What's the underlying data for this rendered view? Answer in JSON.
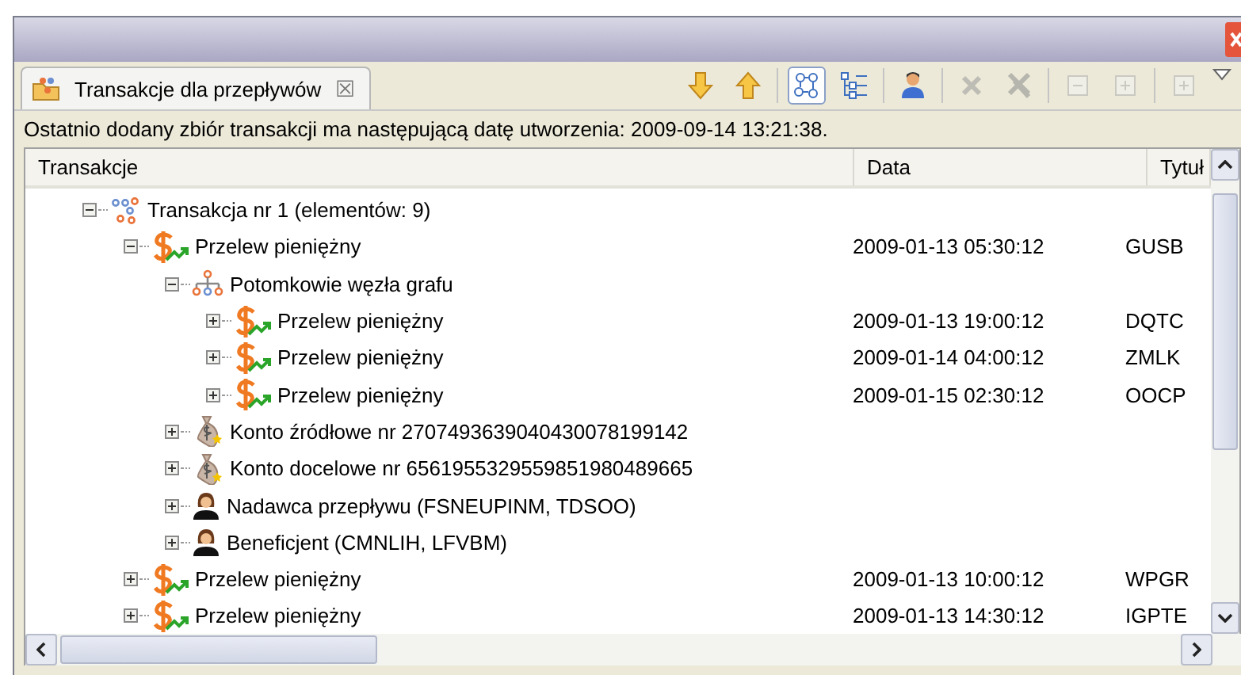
{
  "tab": {
    "label": "Transakcje dla przepływów",
    "close": "☒"
  },
  "toolbar": [
    {
      "kind": "down",
      "selected": false,
      "disabled": false
    },
    {
      "kind": "up",
      "selected": false,
      "disabled": false
    },
    {
      "kind": "graph",
      "selected": true,
      "disabled": false
    },
    {
      "kind": "tree",
      "selected": false,
      "disabled": false
    },
    {
      "kind": "person",
      "selected": false,
      "disabled": false
    },
    {
      "kind": "delete",
      "selected": false,
      "disabled": true
    },
    {
      "kind": "delete-all",
      "selected": false,
      "disabled": true
    },
    {
      "kind": "collapse",
      "selected": false,
      "disabled": true
    },
    {
      "kind": "expand",
      "selected": false,
      "disabled": true
    },
    {
      "kind": "expand",
      "selected": false,
      "disabled": true
    }
  ],
  "info": "Ostatnio dodany zbiór transakcji ma następującą datę utworzenia: 2009-09-14 13:21:38.",
  "table": {
    "columns": [
      "Transakcje",
      "Data",
      "Tytuł"
    ],
    "rows": [
      {
        "kind": "transaction",
        "label": "Transakcja nr 1 (elementów: 9)",
        "expanded": true,
        "children": [
          {
            "kind": "transfer",
            "label": "Przelew pieniężny",
            "date": "2009-01-13 05:30:12",
            "title": "GUSB",
            "expanded": true,
            "children": [
              {
                "kind": "graph",
                "label": "Potomkowie węzła grafu",
                "expanded": true,
                "children": [
                  {
                    "kind": "transfer",
                    "label": "Przelew pieniężny",
                    "date": "2009-01-13 19:00:12",
                    "title": "DQTC",
                    "expanded": false
                  },
                  {
                    "kind": "transfer",
                    "label": "Przelew pieniężny",
                    "date": "2009-01-14 04:00:12",
                    "title": "ZMLK",
                    "expanded": false
                  },
                  {
                    "kind": "transfer",
                    "label": "Przelew pieniężny",
                    "date": "2009-01-15 02:30:12",
                    "title": "OOCP",
                    "expanded": false
                  }
                ]
              },
              {
                "kind": "account",
                "label": "Konto źródłowe nr 2707493639040430078199142",
                "expanded": false
              },
              {
                "kind": "account",
                "label": "Konto docelowe nr 6561955329559851980489665",
                "expanded": false
              },
              {
                "kind": "person",
                "label": "Nadawca przepływu (FSNEUPINM, TDSOO)",
                "expanded": false
              },
              {
                "kind": "person",
                "label": "Beneficjent (CMNLIH, LFVBM)",
                "expanded": false
              }
            ]
          },
          {
            "kind": "transfer",
            "label": "Przelew pieniężny",
            "date": "2009-01-13 10:00:12",
            "title": "WPGR",
            "expanded": false
          },
          {
            "kind": "transfer",
            "label": "Przelew pieniężny",
            "date": "2009-01-13 14:30:12",
            "title": "IGPTE",
            "expanded": false
          }
        ]
      }
    ]
  }
}
